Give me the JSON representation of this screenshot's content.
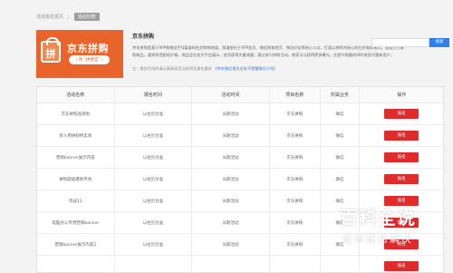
{
  "breadcrumb": {
    "items": [
      "活动报名首页",
      "活动列表"
    ]
  },
  "banner": {
    "title": "京东拼购",
    "tagline": "（ 原 \"拼便宜\" ）",
    "logo_char": "拼"
  },
  "intro": {
    "title": "京东拼购",
    "text": "京东拼购是基于APP和微信手Q渠道的社交购物频道，频道依托于APP首页、微信购物首页、微信好友等核心入口，打造以拼购为核心的社交电商模式。频道主打爆款商品，通常享受超低价格，商品会在各大平台展示，进而获得大量流量；通过参与拼购活动，商家可以获得更多曝光，在提升销量的同时收获大量新用户。",
    "note": "注：报名活动前请认真阅读活动说明及报名要求",
    "note_link": "《京东微信报名会有不提醒情况介绍》"
  },
  "search": {
    "placeholder": "",
    "button_label": "搜索"
  },
  "table": {
    "headers": [
      "活动名称",
      "报名时间",
      "活动时间",
      "项目名称",
      "所属业务",
      "操作"
    ],
    "rows": [
      [
        "京东拼购品牌街",
        "以往历为准",
        "长期活动",
        "京东拼购",
        "微信",
        "报名"
      ],
      [
        "新人用拼购特卖周",
        "以往历为准",
        "长期活动",
        "京东拼购",
        "微信",
        "报名"
      ],
      [
        "营销banner展示内容",
        "以往历为准",
        "长期活动",
        "京东拼购",
        "微信",
        "报名"
      ],
      [
        "拼购超级爆款专场",
        "以往历为准",
        "长期活动",
        "京东拼购",
        "微信",
        "报名"
      ],
      [
        "作战11",
        "以往历为准",
        "长期活动",
        "京东拼购",
        "微信",
        "报名"
      ],
      [
        "电脑办公专用营销banner",
        "以往历为准",
        "长期活动",
        "京东拼购",
        "微信",
        "报名"
      ],
      [
        "营销banner展示内容2",
        "以往历为准",
        "长期活动",
        "京东拼购",
        "微信",
        "报名"
      ],
      [
        "",
        "",
        "",
        "",
        "",
        "报名"
      ]
    ]
  },
  "watermark": {
    "title": "百科全说",
    "subtitle": "助你轻松解决"
  },
  "colors": {
    "banner_bg": "#e8642a",
    "signup_button": "#e02b2b",
    "search_button": "#2f80ed",
    "link": "#3a7bd5"
  }
}
